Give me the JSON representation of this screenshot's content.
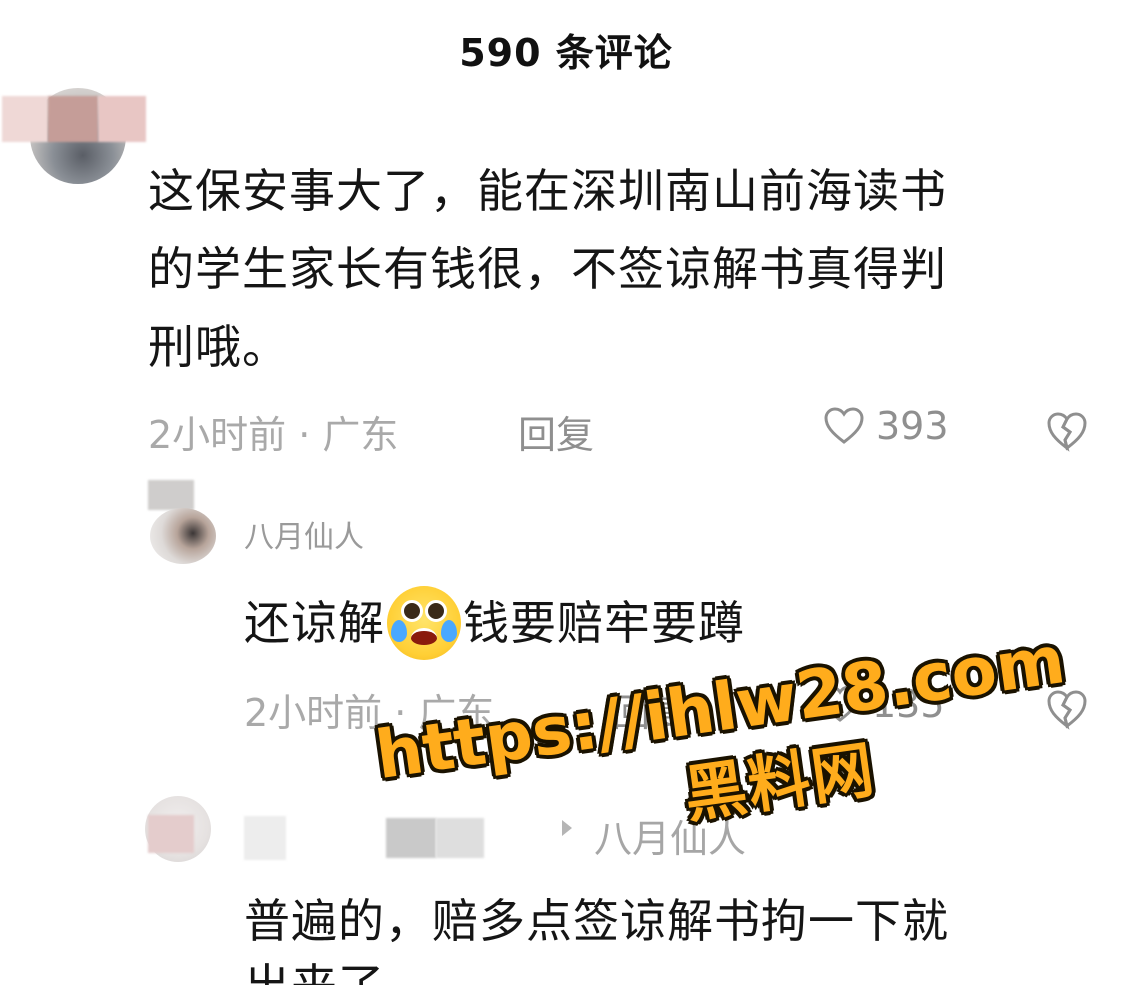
{
  "header": {
    "title": "590 条评论"
  },
  "comments": [
    {
      "text": "这保安事大了，能在深圳南山前海读书\n的学生家长有钱很，不签谅解书真得判\n刑哦。",
      "time_location": "2小时前 · 广东",
      "reply_label": "回复",
      "likes": "393"
    },
    {
      "username": "八月仙人",
      "text_before": "还谅解",
      "emoji_icon": "crying-emoji-icon",
      "text_after": "钱要赔牢要蹲",
      "time_location": "2小时前 · 广东",
      "reply_label": "回复",
      "likes": "135"
    },
    {
      "reply_to": "八月仙人",
      "text": "普遍的，赔多点签谅解书拘一下就",
      "text_cutoff": "出来了"
    }
  ],
  "watermark": {
    "url": "https://ihlw28.com",
    "text": "黑料网"
  }
}
